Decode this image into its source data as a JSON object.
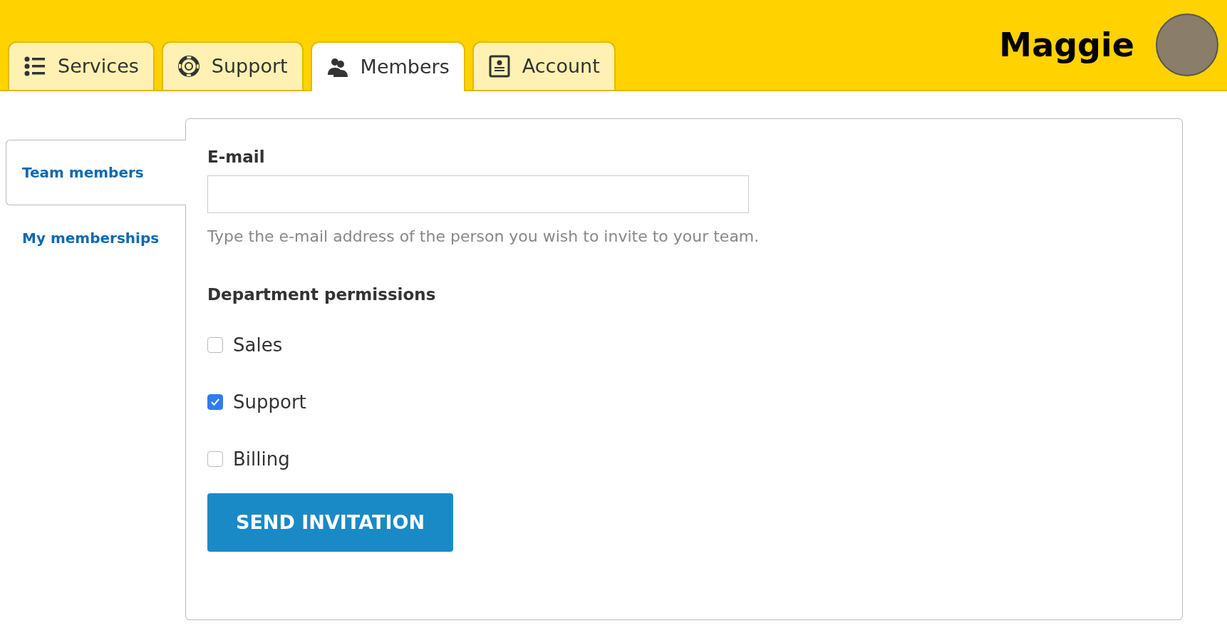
{
  "tabs": [
    {
      "label": "Services",
      "selected": false
    },
    {
      "label": "Support",
      "selected": false
    },
    {
      "label": "Members",
      "selected": true
    },
    {
      "label": "Account",
      "selected": false
    }
  ],
  "user": {
    "name": "Maggie"
  },
  "sidebar": {
    "items": [
      {
        "label": "Team members",
        "selected": true
      },
      {
        "label": "My memberships",
        "selected": false
      }
    ]
  },
  "form": {
    "email": {
      "label": "E-mail",
      "help": "Type the e-mail address of the person you wish to invite to your team."
    },
    "permissions": {
      "title": "Department permissions",
      "options": [
        {
          "label": "Sales",
          "checked": false
        },
        {
          "label": "Support",
          "checked": true
        },
        {
          "label": "Billing",
          "checked": false
        }
      ]
    },
    "submit": "SEND INVITATION"
  }
}
